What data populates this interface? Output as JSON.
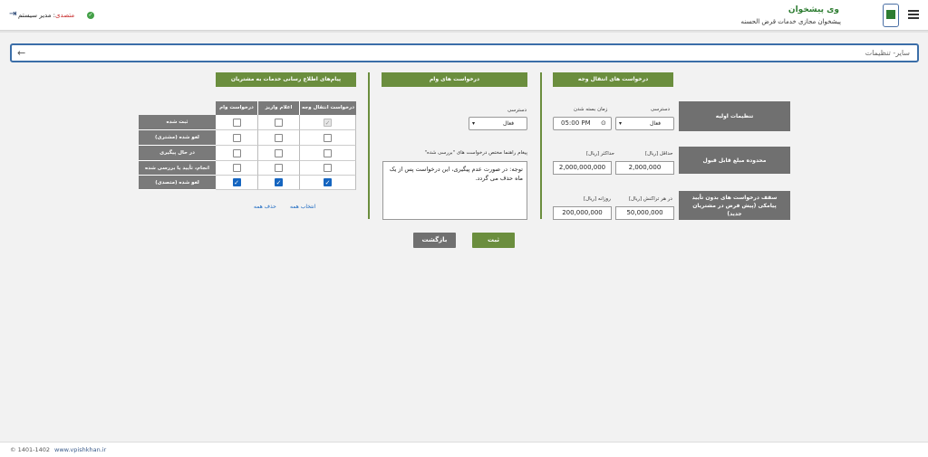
{
  "header": {
    "title": "وی پیشخوان",
    "subtitle": "پیشخوان مجازی خدمات قرض الحسنه",
    "user_role": "متصدی",
    "user_name": "مدیر سیستم"
  },
  "breadcrumb": {
    "text": "سایر- تنظیمات"
  },
  "transfer_section": {
    "title": "درخواست های انتقال وجه",
    "initial_settings_label": "تنظیمات اولیه",
    "access_label": "دسترسی",
    "access_value": "فعال",
    "close_time_label": "زمان بسته شدن",
    "close_time_value": "05:00 PM",
    "range_label": "محدوده مبلغ قابل قبول",
    "min_label": "حداقل [ریال]",
    "min_value": "2,000,000",
    "max_label": "حداکثر [ریال]",
    "max_value": "2,000,000,000",
    "cap_label": "سقف درخواست های بدون تأیید پیامکی (پیش فرض در مشتریان جدید)",
    "per_tx_label": "در هر تراکنش [ریال]",
    "per_tx_value": "50,000,000",
    "daily_label": "روزانه [ریال]",
    "daily_value": "200,000,000"
  },
  "loan_section": {
    "title": "درخواست های وام",
    "access_label": "دسترسی",
    "access_value": "فعال",
    "message_label": "پیغام راهنما مختص درخواست های \"بررسی شده\"",
    "message_value": "توجه: در صورت عدم پیگیری، این درخواست پس از یک ماه حذف می گردد."
  },
  "notify_section": {
    "title": "پیام‌های اطلاع رسانی خدمات به مشتریان",
    "columns": [
      "درخواست انتقال وجه",
      "اعلام واریز",
      "درخواست وام"
    ],
    "rows": [
      {
        "label": "ثبت شده",
        "values": [
          "disabled-checked",
          "unchecked",
          "unchecked"
        ]
      },
      {
        "label": "لغو شده (مشتری)",
        "values": [
          "unchecked",
          "unchecked",
          "unchecked"
        ]
      },
      {
        "label": "در حال پیگیری",
        "values": [
          "unchecked",
          "unchecked",
          "unchecked"
        ]
      },
      {
        "label": "انجام، تأیید یا بررسی شده",
        "values": [
          "unchecked",
          "unchecked",
          "unchecked"
        ]
      },
      {
        "label": "لغو شده (متصدی)",
        "values": [
          "checked",
          "checked",
          "checked"
        ]
      }
    ],
    "select_all": "انتخاب همه",
    "remove_all": "حذف همه"
  },
  "actions": {
    "submit": "ثبت",
    "back": "بازگشت",
    "submit_color": "#6b8e3e",
    "back_color": "#707070"
  },
  "footer": {
    "copyright": "© 1401-1402",
    "url": "www.vpishkhan.ir"
  }
}
